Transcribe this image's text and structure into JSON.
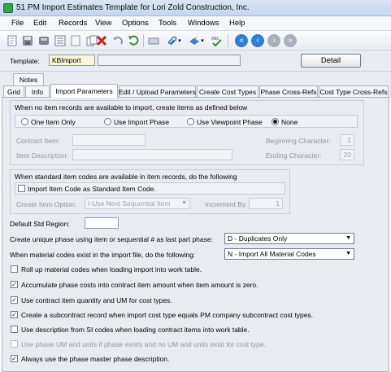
{
  "window": {
    "title": "51 PM Import Estimates Template for Lori Zold Construction, Inc."
  },
  "menu": [
    "File",
    "Edit",
    "Records",
    "View",
    "Options",
    "Tools",
    "Windows",
    "Help"
  ],
  "template": {
    "label": "Template:",
    "value": "KBImport",
    "description": "",
    "detail_button": "Detail"
  },
  "tabs": {
    "row1": [
      "Notes"
    ],
    "row2": [
      "Grid",
      "Info",
      "Import Parameters",
      "Edit / Upload Parameters",
      "Create Cost Types",
      "Phase Cross-Refs",
      "Cost Type Cross-Refs"
    ],
    "active": "Import Parameters"
  },
  "group1": {
    "title": "When no item records are available to import, create items as defined below",
    "options": [
      "One Item Only",
      "Use Import Phase",
      "Use Viewpoint Phase",
      "None"
    ],
    "selected": "None",
    "contract_item_label": "Contract Item:",
    "contract_item_value": "",
    "item_description_label": "Item Description:",
    "item_description_value": "",
    "beginning_char_label": "Beginning Character:",
    "beginning_char_value": "1",
    "ending_char_label": "Ending Character:",
    "ending_char_value": "20"
  },
  "group2": {
    "title": "When standard item codes are available in item records, do the following",
    "checkbox_label": "Import Item Code as Standard Item Code.",
    "checked": false,
    "create_item_option_label": "Create Item Option:",
    "create_item_option_value": "I-Use Next Sequential Item",
    "increment_by_label": "Increment By:",
    "increment_by_value": "1"
  },
  "default_std_region": {
    "label": "Default Std Region:",
    "value": ""
  },
  "unique_phase": {
    "label": "Create unique phase using item or sequential # as last part phase:",
    "value": "D - Duplicates Only"
  },
  "material_codes": {
    "label": "When material codes exist in the import file, do the following:",
    "value": "N - Import All Material Codes"
  },
  "checkboxes": [
    {
      "label": "Roll up material codes when loading import into work table.",
      "checked": false,
      "enabled": true
    },
    {
      "label": "Accumulate phase costs into contract item amount when item amount is zero.",
      "checked": true,
      "enabled": true
    },
    {
      "label": "Use contract item quantity and UM for cost types.",
      "checked": true,
      "enabled": true
    },
    {
      "label": "Create a subcontract record when import cost type equals PM company subcontract cost types.",
      "checked": true,
      "enabled": true
    },
    {
      "label": "Use description from SI codes when loading contract items into work table.",
      "checked": false,
      "enabled": true
    },
    {
      "label": "Use phase UM and units if phase exists and no UM and units exist for cost type.",
      "checked": false,
      "enabled": false
    },
    {
      "label": "Always use the phase master phase description.",
      "checked": true,
      "enabled": true
    }
  ],
  "icons": [
    "app-icon",
    "new-record-icon",
    "save-icon",
    "delete-icon",
    "undo-icon",
    "refresh-icon",
    "clear-icon",
    "attach-icon",
    "attach-menu-icon",
    "print-icon",
    "print-menu-icon",
    "spellcheck-icon",
    "first-record-icon",
    "previous-record-icon",
    "next-record-icon",
    "last-record-icon"
  ]
}
